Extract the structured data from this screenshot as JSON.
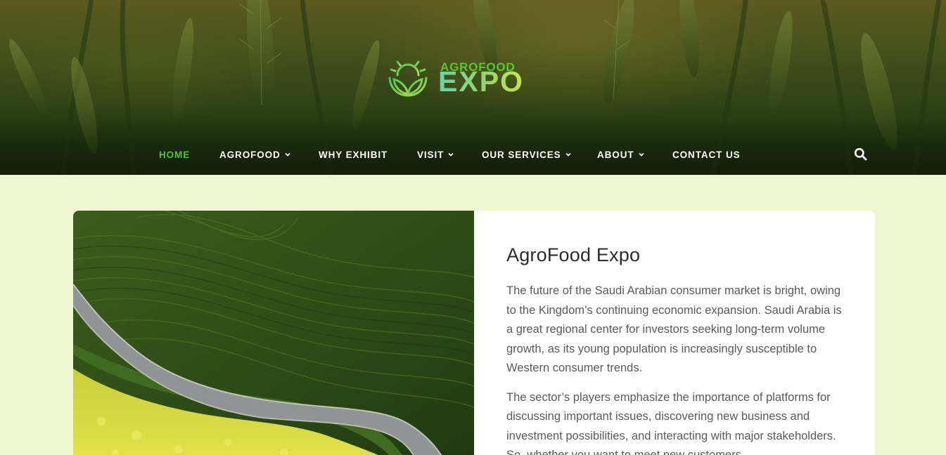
{
  "brand": {
    "logo_top": "AGROFOOD",
    "logo_main": "EXPO",
    "logo_icon": "sun-leaves-icon",
    "colors": {
      "accent_green": "#55c233",
      "logo_gradient_start": "#6fd0a6",
      "logo_gradient_end": "#c8e34a"
    }
  },
  "nav": {
    "items": [
      {
        "label": "HOME",
        "active": true,
        "has_dropdown": false
      },
      {
        "label": "AGROFOOD",
        "active": false,
        "has_dropdown": true
      },
      {
        "label": "WHY EXHIBIT",
        "active": false,
        "has_dropdown": false
      },
      {
        "label": "VISIT",
        "active": false,
        "has_dropdown": true
      },
      {
        "label": "OUR SERVICES",
        "active": false,
        "has_dropdown": true
      },
      {
        "label": "ABOUT",
        "active": false,
        "has_dropdown": true
      },
      {
        "label": "CONTACT US",
        "active": false,
        "has_dropdown": false
      }
    ],
    "search_icon": "search-icon"
  },
  "intro": {
    "title": "AgroFood Expo",
    "paragraphs": [
      "The future of the Saudi Arabian consumer market is bright, owing to the Kingdom’s continuing economic expansion. Saudi Arabia is a great regional center for investors seeking long-term volume growth, as its young population is increasingly susceptible to Western consumer trends.",
      "The sector’s players emphasize the importance of platforms for discussing important issues, discovering new business and investment possibilities, and interacting with major stakeholders. So, whether you want to meet new customers"
    ]
  },
  "page_background": "#eef7cf"
}
